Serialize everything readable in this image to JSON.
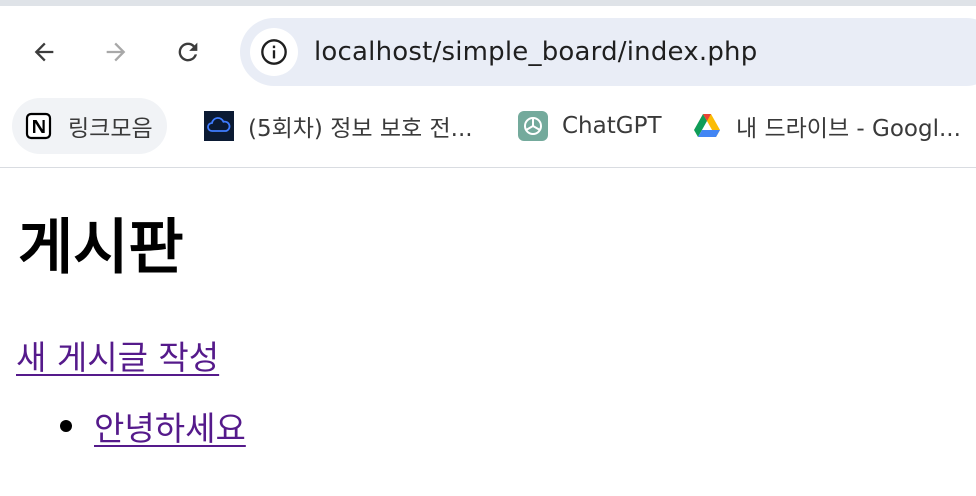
{
  "browser": {
    "url": "localhost/simple_board/index.php",
    "bookmarks": [
      {
        "label": "링크모음",
        "icon": "notion-icon"
      },
      {
        "label": "(5회차) 정보 보호 전...",
        "icon": "cloud-icon"
      },
      {
        "label": "ChatGPT",
        "icon": "chatgpt-icon"
      },
      {
        "label": "내 드라이브 - Googl...",
        "icon": "google-drive-icon"
      }
    ]
  },
  "page": {
    "title": "게시판",
    "new_post_link": "새 게시글 작성",
    "posts": [
      {
        "title": "안녕하세요"
      }
    ]
  },
  "colors": {
    "link_visited": "#551a8b",
    "omnibox_bg": "#e9edf6",
    "chatgpt_green": "#74aa9c"
  }
}
